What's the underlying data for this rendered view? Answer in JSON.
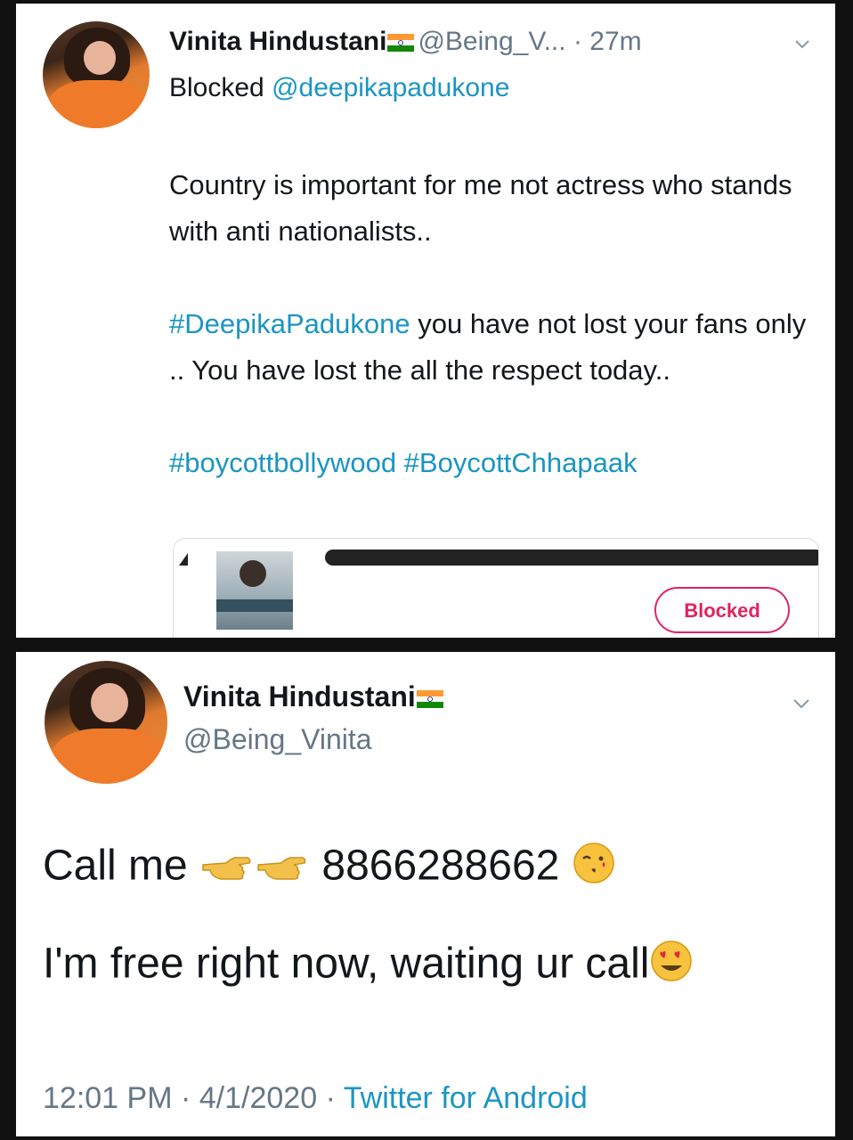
{
  "tweet1": {
    "display_name": "Vinita Hindustani",
    "handle": "@Being_V...",
    "time": "· 27m",
    "reply_prefix": "Blocked",
    "reply_to": "@deepikapadukone",
    "body_line1": "Country is important for me not actress who stands with anti nationalists..",
    "hashtag1": "#DeepikaPadukone",
    "body_line2": " you have not lost your fans only .. You have lost the all the respect today..",
    "hashtags_last": "#boycottbollywood #BoycottChhapaak",
    "card_button": "Blocked"
  },
  "tweet2": {
    "display_name": "Vinita Hindustani",
    "handle": "@Being_Vinita",
    "line1_text": "Call me ",
    "phone": " 8866288662 ",
    "line2_text": "I'm free right now, waiting ur call",
    "time": "12:01 PM",
    "date": "4/1/2020",
    "source": "Twitter for Android"
  },
  "icons": {
    "flag": "india-flag-icon",
    "chevron": "chevron-down-icon",
    "pointing": "backhand-index-pointing-left-icon",
    "kiss": "face-blowing-kiss-icon",
    "heart_eyes": "smiling-face-heart-eyes-icon"
  },
  "colors": {
    "link": "#1b95c4",
    "blocked": "#e0245e",
    "muted": "#657786"
  }
}
